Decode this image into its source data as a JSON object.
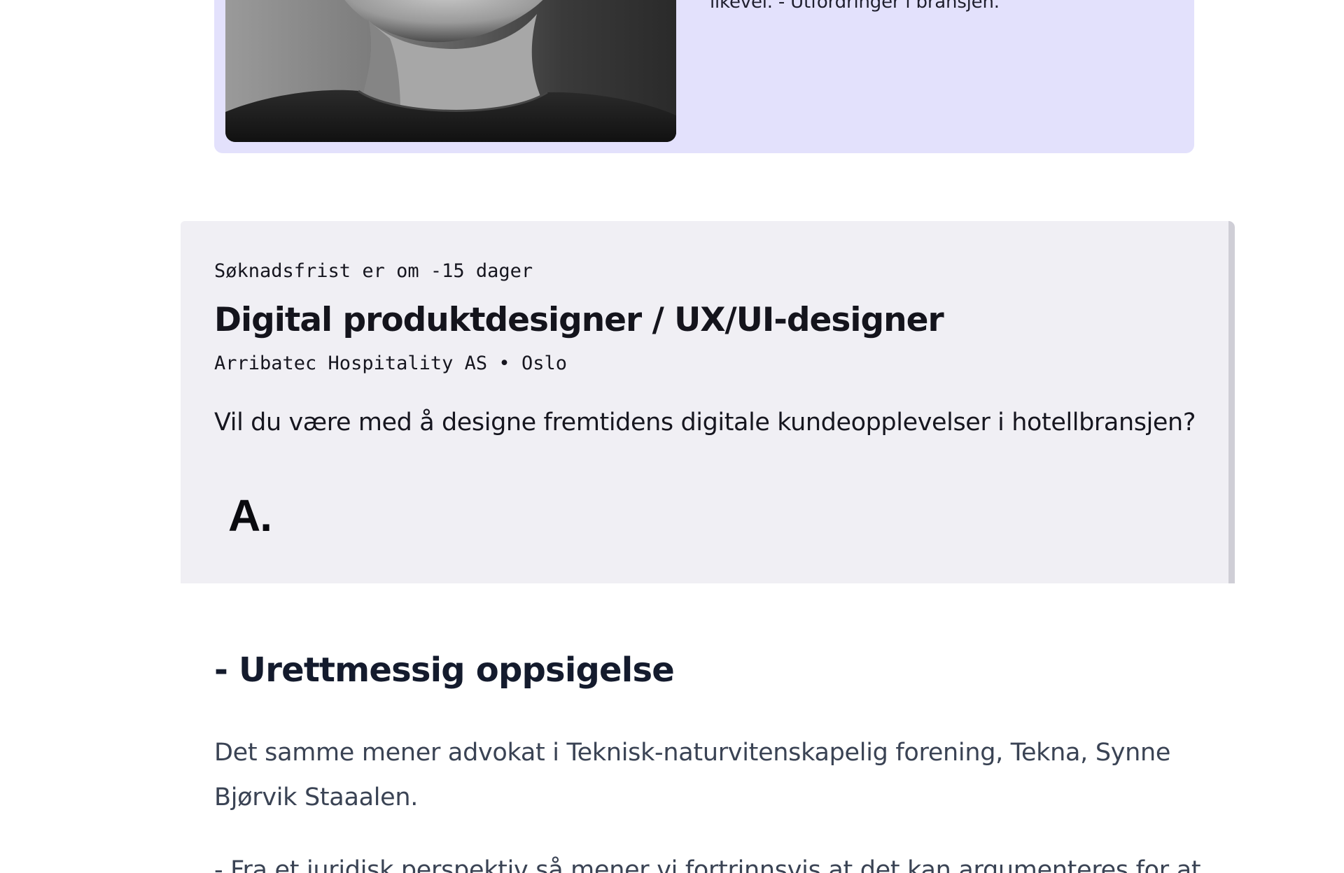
{
  "related_article": {
    "excerpt": "likevel. - Utfordringer i bransjen.",
    "image_alt": "Svart-hvitt portrett"
  },
  "job_ad": {
    "deadline": "Søknadsfrist er om -15 dager",
    "title": "Digital produktdesigner / UX/UI-designer",
    "company": "Arribatec Hospitality AS",
    "separator": "•",
    "location": "Oslo",
    "description": "Vil du være med å designe fremtidens digitale kundeopplevelser i hotellbransjen?",
    "logo_text": "A."
  },
  "article": {
    "heading": "- Urettmessig oppsigelse",
    "paragraph_1": "Det samme mener advokat i Teknisk-naturvitenskapelig forening, Tekna, Synne Bjørvik Staaalen.",
    "paragraph_2": "- Fra et juridisk perspektiv så mener vi fortrinnsvis at det kan argumenteres for at"
  },
  "colors": {
    "related_card_bg": "#e3e1fc",
    "job_card_bg": "#f0eff4",
    "heading_text": "#141b2d",
    "body_text": "#3a4354"
  }
}
